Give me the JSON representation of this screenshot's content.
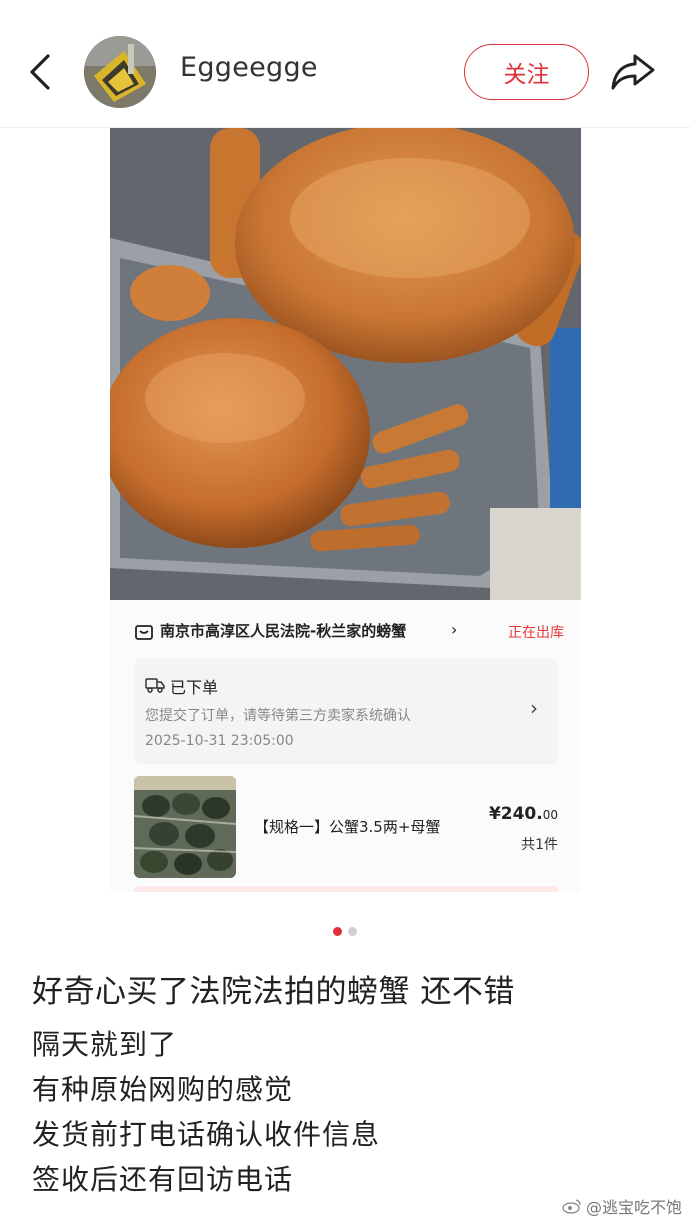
{
  "header": {
    "username": "Eggeegge",
    "follow_label": "关注"
  },
  "order": {
    "shop_name": "南京市高淳区人民法院-秋兰家的螃蟹",
    "shop_chevron": "›",
    "shop_status": "正在出库",
    "status_title": "已下单",
    "status_desc": "您提交了订单，请等待第三方卖家系统确认",
    "status_time": "2025-10-31 23:05:00",
    "status_chevron": "›",
    "spec": "【规格一】公蟹3.5两+母蟹",
    "price_main": "¥240.",
    "price_decimal": "00",
    "quantity": "共1件"
  },
  "carousel": {
    "total": 2,
    "active": 1
  },
  "post": {
    "title": "好奇心买了法院法拍的螃蟹 还不错",
    "lines": [
      "隔天就到了",
      "有种原始网购的感觉",
      "发货前打电话确认收件信息",
      "签收后还有回访电话"
    ]
  },
  "watermark": "@逃宝吃不饱",
  "colors": {
    "accent": "#e0303a",
    "text": "#222222",
    "muted": "#888888"
  },
  "icons": [
    "back-arrow-icon",
    "share-icon",
    "shop-icon",
    "truck-icon",
    "weibo-icon"
  ]
}
